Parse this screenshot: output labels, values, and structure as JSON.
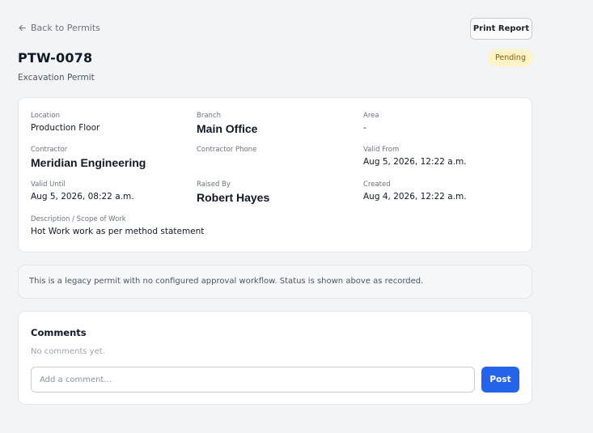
{
  "header": {
    "back_label": "Back to Permits",
    "print_label": "Print Report",
    "permit_id": "PTW-0078",
    "permit_type": "Excavation Permit",
    "status": "Pending"
  },
  "details": {
    "location": {
      "label": "Location",
      "value": "Production Floor"
    },
    "branch": {
      "label": "Branch",
      "value": "Main Office"
    },
    "area": {
      "label": "Area",
      "value": "-"
    },
    "contractor": {
      "label": "Contractor",
      "value": "Meridian Engineering"
    },
    "contractor_phone": {
      "label": "Contractor Phone",
      "value": ""
    },
    "valid_from": {
      "label": "Valid From",
      "value": "Aug 5, 2026, 12:22 a.m."
    },
    "valid_until": {
      "label": "Valid Until",
      "value": "Aug 5, 2026, 08:22 a.m."
    },
    "raised_by": {
      "label": "Raised By",
      "value": "Robert Hayes"
    },
    "created": {
      "label": "Created",
      "value": "Aug 4, 2026, 12:22 a.m."
    },
    "description": {
      "label": "Description / Scope of Work",
      "value": "Hot Work work as per method statement"
    }
  },
  "notice": {
    "text": "This is a legacy permit with no configured approval workflow. Status is shown above as recorded."
  },
  "comments": {
    "title": "Comments",
    "empty_text": "No comments yet.",
    "input_placeholder": "Add a comment...",
    "input_value": "",
    "post_label": "Post"
  }
}
